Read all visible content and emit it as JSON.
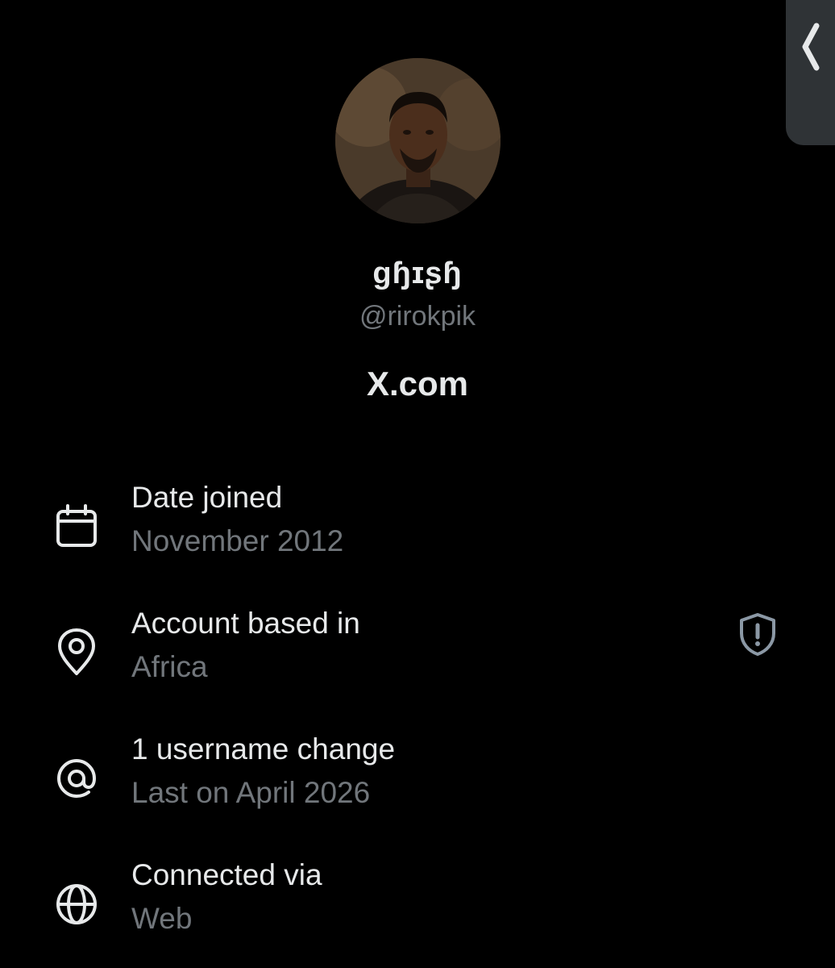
{
  "profile": {
    "display_name": "ɡɧɪʂɧ",
    "handle": "@rirokpik",
    "site": "X.com"
  },
  "details": [
    {
      "icon": "calendar-icon",
      "title": "Date joined",
      "subtitle": "November 2012"
    },
    {
      "icon": "location-pin-icon",
      "title": "Account based in",
      "subtitle": "Africa",
      "aux_icon": "shield-alert-icon"
    },
    {
      "icon": "at-sign-icon",
      "title": "1 username change",
      "subtitle": "Last on April 2026"
    },
    {
      "icon": "globe-icon",
      "title": "Connected via",
      "subtitle": "Web"
    }
  ],
  "colors": {
    "background": "#000000",
    "primary_text": "#e7e9ea",
    "secondary_text": "#71767b",
    "tab_background": "#2f3336"
  }
}
